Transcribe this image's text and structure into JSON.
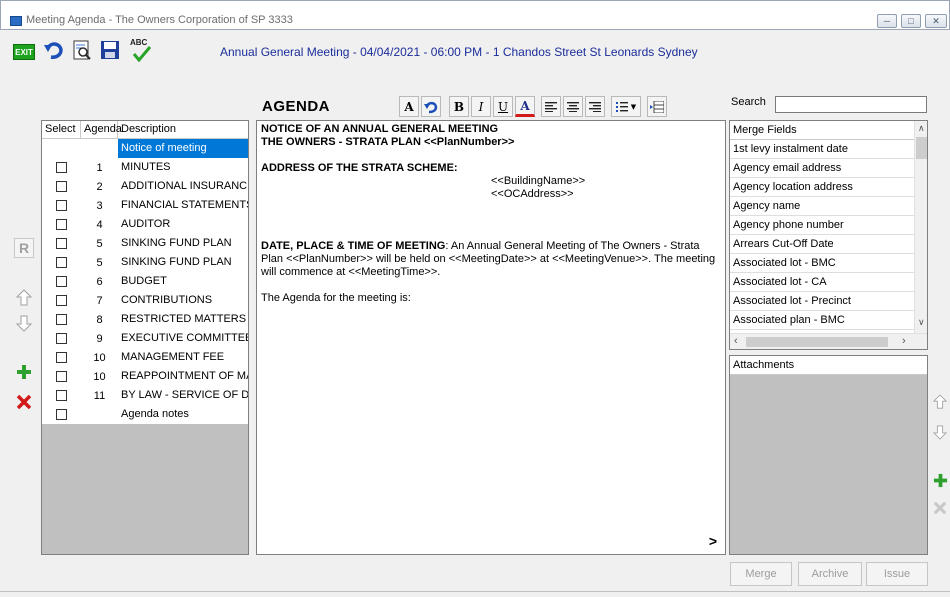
{
  "window": {
    "title": "Meeting Agenda - The Owners Corporation of SP 3333",
    "controls": [
      "minimize",
      "maximize",
      "close"
    ]
  },
  "toolbar": {
    "exit_label": "EXIT",
    "spell_label": "ABC",
    "buttons": [
      "exit-icon",
      "undo-icon",
      "preview-icon",
      "save-icon",
      "spellcheck-icon"
    ]
  },
  "meeting_heading": "Annual General Meeting - 04/04/2021 - 06:00 PM - 1 Chandos Street St Leonards Sydney",
  "left_controls": {
    "r_label": "R"
  },
  "agenda_table": {
    "columns": [
      "Select",
      "Agenda",
      "Description"
    ],
    "rows": [
      {
        "num": "",
        "desc": "Notice of meeting",
        "selected": true
      },
      {
        "num": "1",
        "desc": "MINUTES"
      },
      {
        "num": "2",
        "desc": "ADDITIONAL INSURANCE"
      },
      {
        "num": "3",
        "desc": "FINANCIAL STATEMENTS"
      },
      {
        "num": "4",
        "desc": "AUDITOR"
      },
      {
        "num": "5",
        "desc": "SINKING FUND PLAN"
      },
      {
        "num": "5",
        "desc": "SINKING FUND PLAN"
      },
      {
        "num": "6",
        "desc": "BUDGET"
      },
      {
        "num": "7",
        "desc": "CONTRIBUTIONS"
      },
      {
        "num": "8",
        "desc": "RESTRICTED MATTERS"
      },
      {
        "num": "9",
        "desc": "EXECUTIVE COMMITTEE"
      },
      {
        "num": "10",
        "desc": "MANAGEMENT FEE"
      },
      {
        "num": "10",
        "desc": "REAPPOINTMENT OF MAI"
      },
      {
        "num": "11",
        "desc": "BY LAW - SERVICE OF DO"
      },
      {
        "num": "",
        "desc": "Agenda notes"
      }
    ]
  },
  "editor": {
    "label": "AGENDA",
    "format_buttons": {
      "font": "A",
      "bold": "B",
      "italic": "I",
      "underline": "U",
      "color": "A"
    },
    "content": {
      "line1": "NOTICE OF AN ANNUAL GENERAL MEETING",
      "line2": "THE OWNERS - STRATA PLAN <<PlanNumber>>",
      "address_heading": "ADDRESS OF THE STRATA SCHEME:",
      "building": "<<BuildingName>>",
      "oc_address": "<<OCAddress>>",
      "date_heading": "DATE, PLACE & TIME OF MEETING",
      "date_text": ": An Annual General Meeting of The Owners - Strata Plan <<PlanNumber>> will be held on <<MeetingDate>> at <<MeetingVenue>>. The meeting will commence at <<MeetingTime>>.",
      "agenda_intro": "The Agenda for the meeting is:"
    },
    "next_label": ">"
  },
  "search": {
    "label": "Search",
    "value": ""
  },
  "merge_fields": {
    "header": "Merge Fields",
    "items": [
      "1st levy instalment date",
      "Agency email address",
      "Agency location address",
      "Agency name",
      "Agency phone number",
      "Arrears Cut-Off Date",
      "Associated lot - BMC",
      "Associated lot - CA",
      "Associated lot - Precinct",
      "Associated plan - BMC"
    ]
  },
  "attachments": {
    "header": "Attachments"
  },
  "bottom_buttons": {
    "merge": "Merge",
    "archive": "Archive",
    "issue": "Issue"
  },
  "colors": {
    "selection": "#0078d7",
    "heading_text": "#1b2d9a",
    "add_green": "#2ea02e",
    "delete_red": "#d21a1a"
  }
}
